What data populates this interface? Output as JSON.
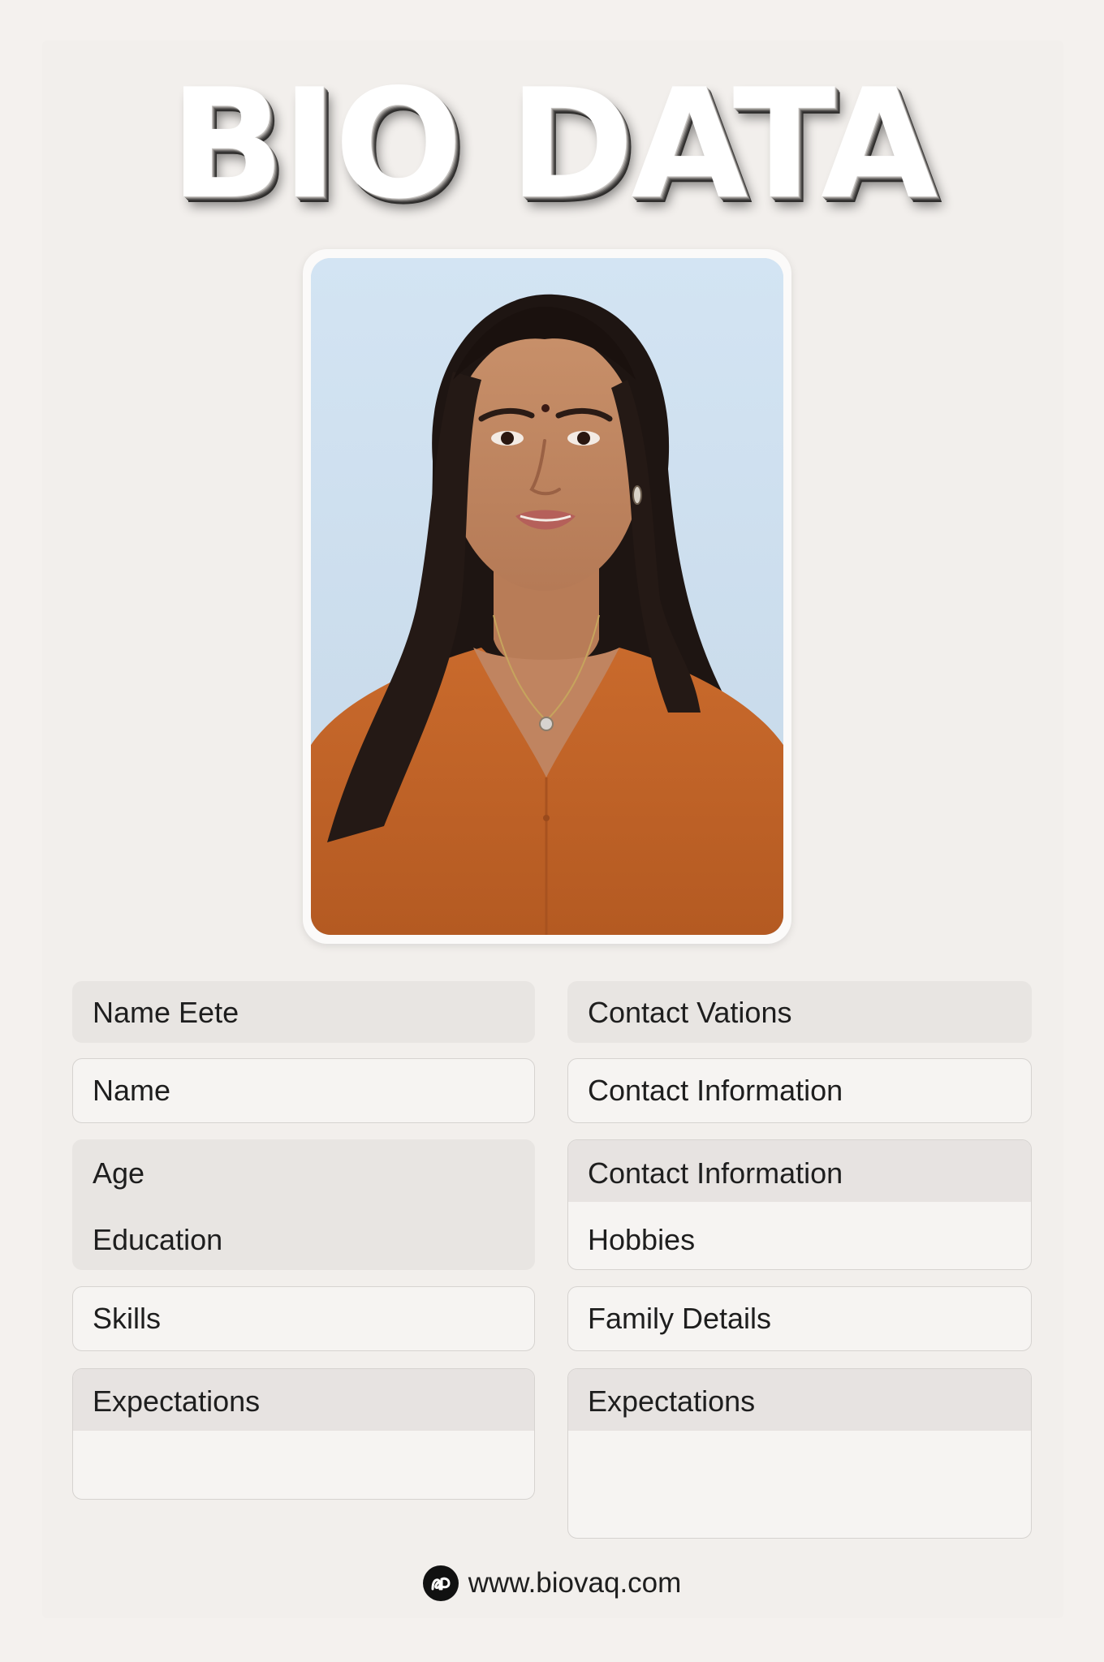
{
  "title": "BIO DATA",
  "photo": {
    "description_icon": "portrait-photo"
  },
  "fields": {
    "name_eete": "Name Eete",
    "contact_vations": "Contact Vations",
    "name": "Name",
    "contact_information_1": "Contact Information",
    "age": "Age",
    "education": "Education",
    "contact_information_2": "Contact Information",
    "hobbies": "Hobbies",
    "skills": "Skills",
    "family_details": "Family Details",
    "expectations_left": "Expectations",
    "expectations_right": "Expectations"
  },
  "footer": {
    "url": "www.biovaq.com",
    "icon": "biovaq-logo-icon"
  },
  "colors": {
    "background": "#f4f1ee",
    "field_fill": "#e8e5e2",
    "field_border": "#d6d3d0",
    "shirt": "#c0642a",
    "photo_bg": "#cfe0ef"
  }
}
